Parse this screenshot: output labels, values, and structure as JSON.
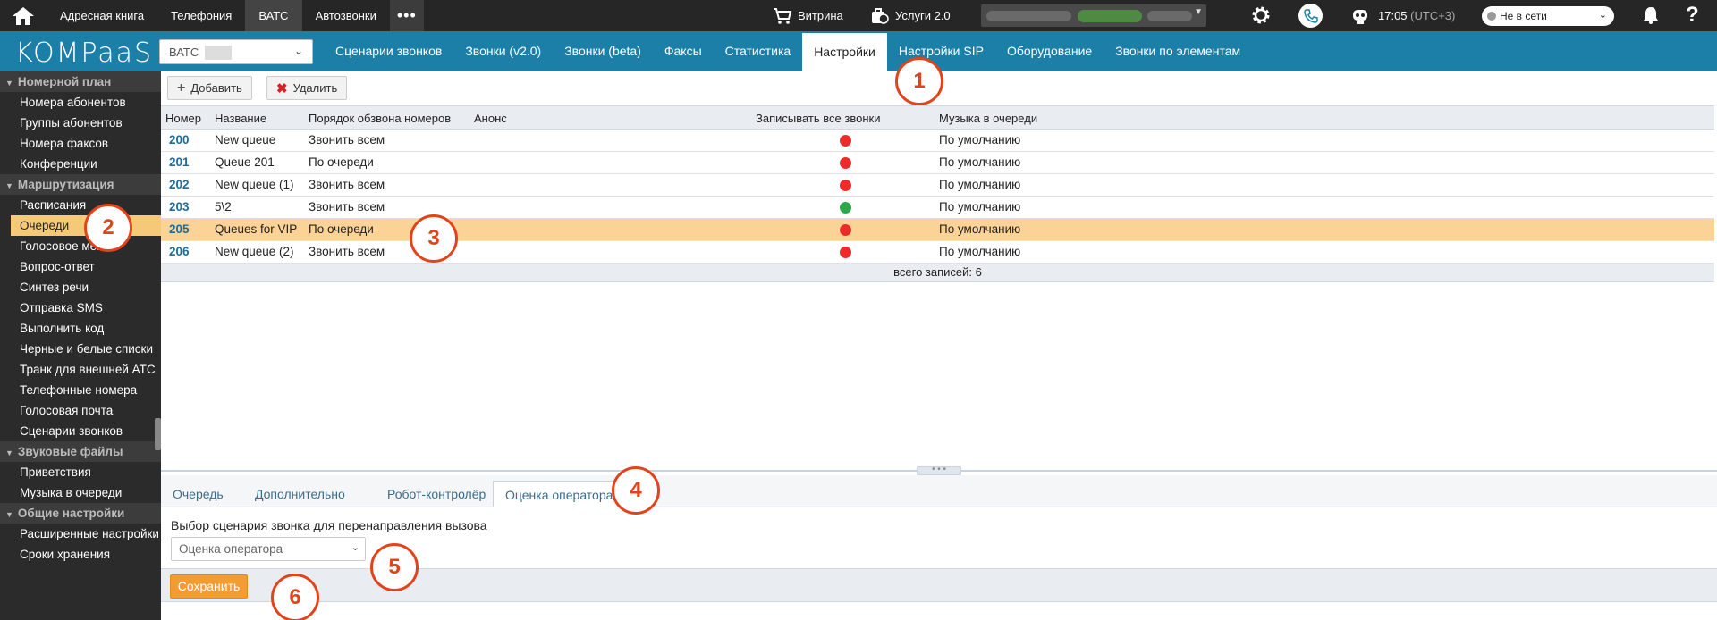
{
  "topbar": {
    "nav": [
      "Адресная книга",
      "Телефония",
      "ВАТС",
      "Автозвонки"
    ],
    "active_nav_index": 2,
    "more": "•••",
    "shop": "Витрина",
    "services": "Услуги 2.0",
    "time": "17:05",
    "timezone": "(UTC+3)",
    "status": "Не в сети",
    "help": "?"
  },
  "navbar": {
    "logo": "KOMPaaS",
    "pbx_select": "ВАТС",
    "tabs": [
      "Сценарии звонков",
      "Звонки (v2.0)",
      "Звонки (beta)",
      "Факсы",
      "Статистика",
      "Настройки",
      "Настройки SIP",
      "Оборудование",
      "Звонки по элементам"
    ],
    "active_tab_index": 5
  },
  "sidebar": {
    "groups": [
      {
        "label": "Номерной план",
        "items": [
          "Номера абонентов",
          "Группы абонентов",
          "Номера факсов",
          "Конференции"
        ]
      },
      {
        "label": "Маршрутизация",
        "items": [
          "Расписания",
          "Очереди",
          "Голосовое меню",
          "Вопрос-ответ",
          "Синтез речи",
          "Отправка SMS",
          "Выполнить код",
          "Черные и белые списки",
          "Транк для внешней АТС",
          "Телефонные номера",
          "Голосовая почта",
          "Сценарии звонков"
        ]
      },
      {
        "label": "Звуковые файлы",
        "items": [
          "Приветствия",
          "Музыка в очереди"
        ]
      },
      {
        "label": "Общие настройки",
        "items": [
          "Расширенные настройки",
          "Сроки хранения"
        ]
      }
    ],
    "active_item": "Очереди"
  },
  "toolbar": {
    "add": "Добавить",
    "delete": "Удалить"
  },
  "grid": {
    "columns": [
      "Номер",
      "Название",
      "Порядок обзвона номеров",
      "Анонс",
      "Записывать все звонки",
      "Музыка в очереди"
    ],
    "rows": [
      {
        "num": "200",
        "name": "New queue",
        "order": "Звонить всем",
        "record": "red",
        "music": "По умолчанию"
      },
      {
        "num": "201",
        "name": "Queue 201",
        "order": "По очереди",
        "record": "red",
        "music": "По умолчанию"
      },
      {
        "num": "202",
        "name": "New queue (1)",
        "order": "Звонить всем",
        "record": "red",
        "music": "По умолчанию"
      },
      {
        "num": "203",
        "name": "5\\2",
        "order": "Звонить всем",
        "record": "green",
        "music": "По умолчанию"
      },
      {
        "num": "205",
        "name": "Queues for VIP",
        "order": "По очереди",
        "record": "red",
        "music": "По умолчанию"
      },
      {
        "num": "206",
        "name": "New queue (2)",
        "order": "Звонить всем",
        "record": "red",
        "music": "По умолчанию"
      }
    ],
    "selected_row_index": 4,
    "footer": "всего записей: 6"
  },
  "bottom_tabs": [
    "Очередь",
    "Дополнительно",
    "Робот-контролёр",
    "Оценка оператора"
  ],
  "active_bottom_tab_index": 3,
  "panel": {
    "label": "Выбор сценария звонка для перенаправления вызова",
    "select_value": "Оценка оператора",
    "save": "Сохранить"
  },
  "callouts": [
    "1",
    "2",
    "3",
    "4",
    "5",
    "6"
  ],
  "colors": {
    "accent": "#1b7fa8",
    "selected_row": "#fbd396",
    "save": "#f39c33",
    "callout": "#e3431b",
    "dot_red": "#ee2b2b",
    "dot_green": "#2ba84a"
  }
}
